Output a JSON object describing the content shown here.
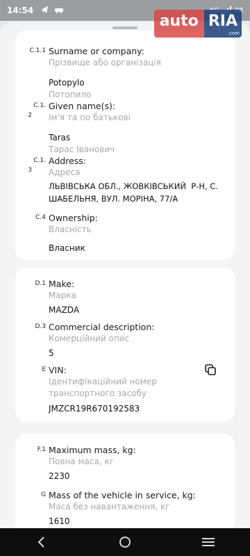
{
  "status": {
    "time": "14:54",
    "signal": "4G",
    "battery": "28"
  },
  "logo": {
    "auto": "auto",
    "ria": "RIA",
    "domain": ".com"
  },
  "card1": {
    "surname": {
      "code": "C.1.1",
      "label": "Surname or company:",
      "sub": "Прізвище або організація",
      "value": "Potopylo",
      "value2": "Потопило"
    },
    "given": {
      "code1": "C.1.",
      "code2": "2",
      "label": "Given name(s):",
      "sub": "Ім'я та по батькові",
      "value": "Taras",
      "value2": "Тарас Іванович"
    },
    "address": {
      "code1": "C.1.",
      "code2": "3",
      "label": "Address:",
      "sub": "Адреса",
      "line1": "ЛЬВІВСЬКА ОБЛ., ЖОВКІВСЬКИЙ  Р-Н, С.",
      "line2": "ШАБЕЛЬНЯ, ВУЛ. МОРІНА, 77/А"
    },
    "ownership": {
      "code": "C.4",
      "label": "Ownership:",
      "sub": "Власність",
      "value": "Власник"
    }
  },
  "card2": {
    "make": {
      "code": "D.1",
      "label": "Make:",
      "sub": "Марка",
      "value": "MAZDA"
    },
    "commercial": {
      "code": "D.3",
      "label": "Commercial description:",
      "sub": "Комерційний опис",
      "value": "5"
    },
    "vin": {
      "code": "E",
      "label": "VIN:",
      "sub1": "Ідентифікаційний номер",
      "sub2": "транспортного засобу",
      "value": "JMZCR19R670192583",
      "icon": "copy-icon"
    }
  },
  "card3": {
    "maxmass": {
      "code": "F.1",
      "label": "Maximum mass, kg:",
      "sub": "Повна маса, кг",
      "value": "2230"
    },
    "mass": {
      "code": "G",
      "label": "Mass of the vehicle in service, kg:",
      "sub": "Маса без навантаження, кг",
      "value": "1610"
    }
  }
}
